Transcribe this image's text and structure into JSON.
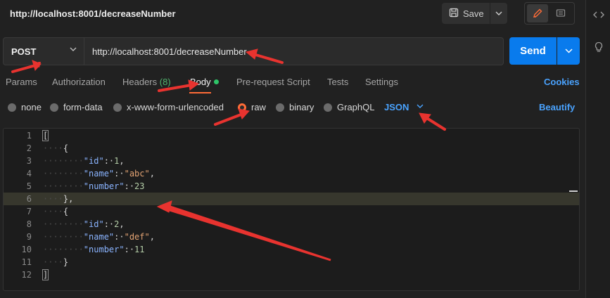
{
  "request": {
    "title": "http://localhost:8001/decreaseNumber",
    "method": "POST",
    "url": "http://localhost:8001/decreaseNumber",
    "save_label": "Save",
    "send_label": "Send"
  },
  "tabs": [
    {
      "label": "Params"
    },
    {
      "label": "Authorization"
    },
    {
      "label": "Headers",
      "count": "(8)"
    },
    {
      "label": "Body",
      "active": true
    },
    {
      "label": "Pre-request Script"
    },
    {
      "label": "Tests"
    },
    {
      "label": "Settings"
    }
  ],
  "cookies_label": "Cookies",
  "body_types": [
    {
      "label": "none"
    },
    {
      "label": "form-data"
    },
    {
      "label": "x-www-form-urlencoded"
    },
    {
      "label": "raw",
      "selected": true
    },
    {
      "label": "binary"
    },
    {
      "label": "GraphQL"
    }
  ],
  "language": "JSON",
  "beautify_label": "Beautify",
  "editor": {
    "line_numbers": [
      "1",
      "2",
      "3",
      "4",
      "5",
      "6",
      "7",
      "8",
      "9",
      "10",
      "11",
      "12"
    ],
    "highlighted_line": "6",
    "lines": [
      {
        "indent": "",
        "text": "["
      },
      {
        "indent": "····",
        "text": "{"
      },
      {
        "indent": "········",
        "key": "\"id\"",
        "sep": ":·",
        "val": "1",
        "val_type": "n",
        "end": ","
      },
      {
        "indent": "········",
        "key": "\"name\"",
        "sep": ":·",
        "val": "\"abc\"",
        "val_type": "s",
        "end": ","
      },
      {
        "indent": "········",
        "key": "\"number\"",
        "sep": ":·",
        "val": "23",
        "val_type": "n",
        "end": ""
      },
      {
        "indent": "····",
        "text": "},"
      },
      {
        "indent": "····",
        "text": "{"
      },
      {
        "indent": "········",
        "key": "\"id\"",
        "sep": ":·",
        "val": "2",
        "val_type": "n",
        "end": ","
      },
      {
        "indent": "········",
        "key": "\"name\"",
        "sep": ":·",
        "val": "\"def\"",
        "val_type": "s",
        "end": ","
      },
      {
        "indent": "········",
        "key": "\"number\"",
        "sep": ":·",
        "val": "11",
        "val_type": "n",
        "end": ""
      },
      {
        "indent": "····",
        "text": "}"
      },
      {
        "indent": "",
        "text": "]"
      }
    ]
  },
  "colors": {
    "accent": "#ff6c37",
    "send": "#097bed",
    "link": "#4aa3ff",
    "body_dot": "#2ec568",
    "annotation_arrow": "#e8332f"
  }
}
